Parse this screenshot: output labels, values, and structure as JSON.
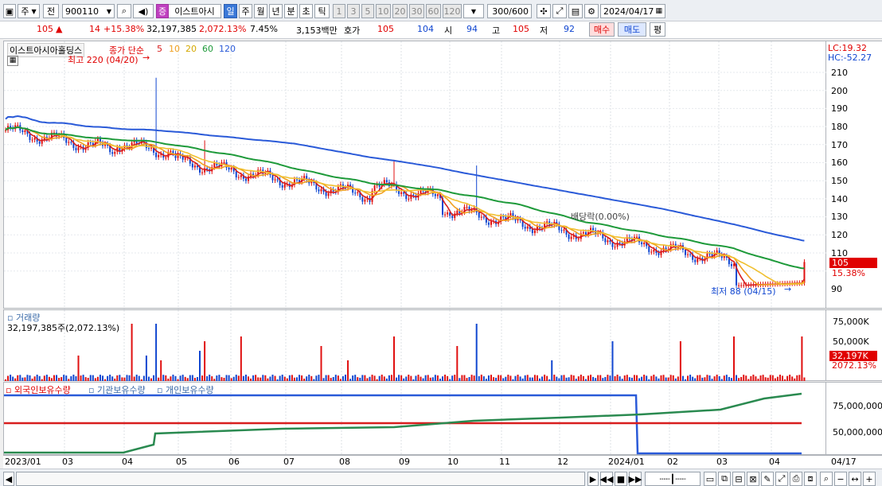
{
  "toolbar": {
    "period_label": "주",
    "prev_label": "전",
    "code_value": "900110",
    "stock_tag": "증",
    "stock_name": "이스트아시",
    "interval_buttons": [
      "일",
      "주",
      "월",
      "년",
      "분",
      "초",
      "틱"
    ],
    "number_buttons": [
      "1",
      "3",
      "5",
      "10",
      "20",
      "30",
      "60",
      "120"
    ],
    "count_value": "300",
    "count_total": "/600",
    "date_value": "2024/04/17"
  },
  "quote": {
    "price": "105",
    "change": "14",
    "change_pct": "+15.38%",
    "volume": "32,197,385",
    "volume_pct": "2,072.13%",
    "turnover_pct": "7.45%",
    "amount": "3,153백만",
    "ask_label": "호가",
    "ask1": "105",
    "ask2": "104",
    "open_label": "시",
    "open": "94",
    "high_label": "고",
    "high": "105",
    "low_label": "저",
    "low": "92",
    "buy_label": "매수",
    "sell_label": "매도",
    "eval_label": "평"
  },
  "price_pane": {
    "stock_title": "이스트아시아홀딩스",
    "ma_title": "종가 단순",
    "ma_periods": [
      "5",
      "10",
      "20",
      "60",
      "120"
    ],
    "ma_colors": [
      "#d81e1e",
      "#f0a020",
      "#f0c030",
      "#1e9a3a",
      "#2a5ad8"
    ],
    "high_annotation": "최고 220 (04/20)",
    "low_annotation": "최저 88 (04/15)",
    "dividend_annotation": "배당락(0.00%)",
    "lc": "LC:19.32",
    "hc": "HC:-52.27",
    "y_ticks": [
      "210",
      "200",
      "190",
      "180",
      "170",
      "160",
      "150",
      "140",
      "130",
      "120",
      "110",
      "90"
    ],
    "current_price": "105",
    "current_pct": "15.38%"
  },
  "volume_pane": {
    "title": "거래량",
    "value": "32,197,385주(2,072.13%)",
    "y_ticks": [
      "75,000K",
      "50,000K"
    ],
    "current": "32,197K",
    "current_pct": "2072.13%"
  },
  "holder_pane": {
    "titles": [
      "외국인보유수량",
      "기관보유수량",
      "개인보유수량"
    ],
    "y_ticks": [
      "75,000,000",
      "50,000,000"
    ]
  },
  "x_axis": [
    "2023/01",
    "03",
    "04",
    "05",
    "06",
    "07",
    "08",
    "09",
    "10",
    "11",
    "12",
    "2024/01",
    "02",
    "03",
    "04",
    "04/17"
  ]
}
